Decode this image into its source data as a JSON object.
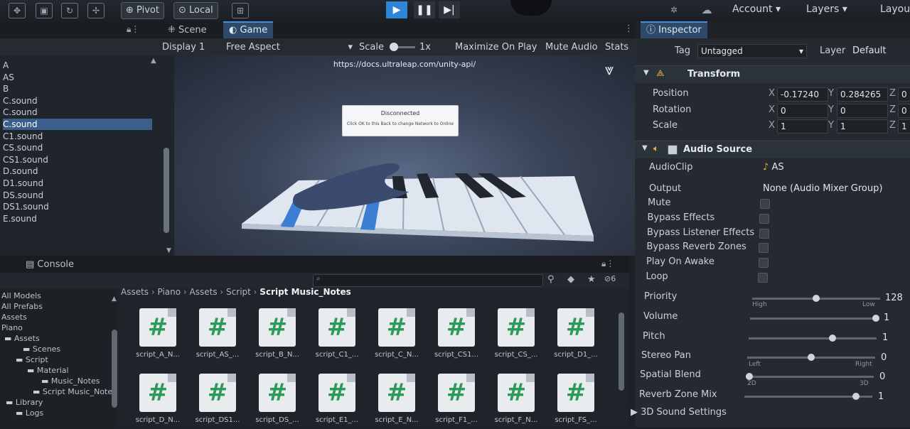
{
  "toolbar": {
    "pivot_label": "Pivot",
    "local_label": "Local",
    "account_label": "Account",
    "layers_label": "Layers",
    "layout_label": "Layout"
  },
  "scene_tabs": {
    "scene": "Scene",
    "game": "Game"
  },
  "game_bar": {
    "display": "Display 1",
    "aspect": "Free Aspect",
    "scale_label": "Scale",
    "scale_value": "1x",
    "maximize": "Maximize On Play",
    "mute": "Mute Audio",
    "stats": "Stats"
  },
  "game_view": {
    "url": "https://docs.ultraleap.com/unity-api/",
    "dialog_title": "Disconnected",
    "dialog_text": "Click OK to this Back to change Network to Online"
  },
  "hierarchy": {
    "items": [
      "A",
      "AS",
      "B",
      "C.sound",
      "C.sound",
      "C.sound",
      "C1.sound",
      "CS.sound",
      "CS1.sound",
      "D.sound",
      "D1.sound",
      "DS.sound",
      "DS1.sound",
      "E.sound"
    ]
  },
  "console_tab": "Console",
  "project": {
    "breadcrumb": [
      "Assets",
      "Piano",
      "Assets",
      "Script",
      "Script Music_Notes"
    ],
    "badge_count": "6",
    "tree": [
      "All Models",
      "All Prefabs",
      "Assets",
      "Piano",
      "Assets",
      "Scenes",
      "Script",
      "Material",
      "Music_Notes",
      "Script Music_Note",
      "Library",
      "Logs"
    ],
    "files_row1": [
      "script_A_N...",
      "script_AS_...",
      "script_B_N...",
      "script_C1_...",
      "script_C_N...",
      "script_CS1...",
      "script_CS_...",
      "script_D1_..."
    ],
    "files_row2": [
      "script_D_N...",
      "script_DS1...",
      "script_DS_...",
      "script_E1_...",
      "script_E_N...",
      "script_F1_...",
      "script_F_N...",
      "script_FS_..."
    ]
  },
  "inspector": {
    "title": "Inspector",
    "tag_label": "Tag",
    "tag_value": "Untagged",
    "layer_label": "Layer",
    "layer_value": "Default",
    "transform": {
      "title": "Transform",
      "position_label": "Position",
      "rotation_label": "Rotation",
      "scale_label": "Scale",
      "position": {
        "x": "-0.17240",
        "y": "0.284265",
        "z": "0"
      },
      "rotation": {
        "x": "0",
        "y": "0",
        "z": "0"
      },
      "scale": {
        "x": "1",
        "y": "1",
        "z": "1"
      }
    },
    "audio": {
      "title": "Audio Source",
      "clip_label": "AudioClip",
      "clip_value": "AS",
      "output_label": "Output",
      "output_value": "None (Audio Mixer Group)",
      "toggles": [
        "Mute",
        "Bypass Effects",
        "Bypass Listener Effects",
        "Bypass Reverb Zones",
        "Play On Awake",
        "Loop"
      ],
      "priority_label": "Priority",
      "priority_value": "128",
      "high_label": "High",
      "low_label": "Low",
      "volume_label": "Volume",
      "volume_value": "1",
      "pitch_label": "Pitch",
      "pitch_value": "1",
      "stereo_label": "Stereo Pan",
      "stereo_value": "0",
      "left_label": "Left",
      "right_label": "Right",
      "spatial_label": "Spatial Blend",
      "spatial_value": "0",
      "spatial_2d": "2D",
      "spatial_3d": "3D",
      "reverb_label": "Reverb Zone Mix",
      "reverb_value": "1",
      "settings_3d": "3D Sound Settings"
    }
  },
  "colors": {
    "accent": "#2f86d6",
    "script_icon": "#2e9a5a"
  }
}
